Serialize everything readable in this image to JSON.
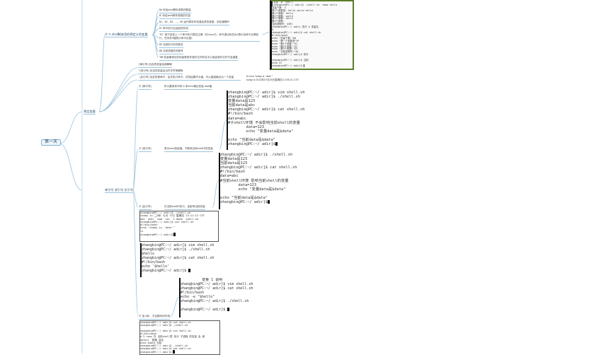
{
  "root": {
    "label": "第一天"
  },
  "branches": {
    "shell_vars": "预定变量",
    "predef": "Ⓟ ✎ shell脚本用的预定义的变量",
    "quotes": "单引号 双引号 反引号"
  },
  "predef_items": [
    "$#    传给shell脚本参数的数量",
    "$*    传给shell脚本参数的内容",
    "$1、$2、$3、...、$9    运行脚本时传递给其的参数，用空格隔开",
    "$?    命令执行后返回的状态",
    "\"$?\" 用于检查上一个命令执行是否正确（在Linux中，命令退出状态为0表示该命令正确执行，任何非0值表示命令出错）",
    "$0    当前执行的进程名",
    "$$    当前进程的进程号",
    "\"$$\"变量最常见的用途是用作临时文件的名字以保证临时文件不会重复"
  ],
  "quote_items": [
    "''(单引号)  包含的变量会被解释",
    "\"\"(双引号)  包含的变量会当作字符串解释",
    "``(反引号)  包含的是命令，会先执行命令，并将结果作为值，可以直接输出为一个变量"
  ],
  "echo_note": [
    "$ echo \"today is `date`\"",
    "today is 2013年07月25日星期四 12:55:21 CST"
  ],
  "single_quote_label": "Ⓟ (单引号)",
  "single_quote_desc": "所以要用到'$'和 \\n 来echo输出变量 data值",
  "double_quote_label": "Ⓟ (双引号)",
  "double_quote_desc": "表示shell变量值，不影响当前shell中的变量",
  "backquote_label": "Ⓟ (反引号)",
  "backquote_desc": "在当前shell中执行，会影响当前变量",
  "export_label": "Ⓟ 加.0和 ., 方包脚本的作用",
  "terminal_top": [
    "▌变量 -p  shell",
    "▌zhangbin@PC:~/ adir]$ ./shell sh  home hello",
    "变量个数: 3",
    "第1个参数是: hello world hello",
    "第1个参数: hello",
    "第2个参数: world",
    "第3个参数: hello",
    "第4个参数: ",
    "当前进程号: 4491",
    "zhangbin@PC:~/ adir] 执行 $ 变量名",
    "0",
    "zhangbin@PC:~/ adir]$ cat shell.sh",
    "#!/bin/bash",
    "echo \"变量个数:\"$#",
    "echo \"第一个参数是\"$*",
    "echo \"第1个参数:\"$1",
    "echo \"第2个参数:\"$2",
    "echo \"第3个参数:\"$3",
    "echo \"当前进程号:\"$$",
    "zhangbin@PC:~/ adir]$ 执行",
    "",
    "zhangbin@PC:~/ adir]$ 当前",
    "echo $?",
    "zhangbin@PC:~/ adir]$ ▌"
  ],
  "terminal_single": [
    "zhangbin@PC:~/ adir]$ vim shell.sh",
    "zhangbin@PC:~/ adir]$ ./shell.sh",
    "变量data是123",
    "当前data是abc",
    "zhangbin@PC:~/ adir]$ cat shell.sh",
    "#!/bin/bash",
    "data=abc",
    "#子shell环境 不会影响当前shell的变量",
    "        data=123",
    "        echo \"变量data是$data\"",
    "",
    "echo \"当前data是$data\"",
    "zhangbin@PC:~/ adir]$"
  ],
  "terminal_double": [
    "zhangbin@PC:~/ adir]$ ./shell.sh",
    "变量data是123",
    "当前data是123",
    "zhangbin@PC:~/ adir]$ cat shell.sh",
    "#!/bin/bash",
    "data=abc",
    "#当前shell环境 影响当前shell的变量",
    "        data=123",
    "        echo \"变量data是$data\"",
    "",
    "echo \"当前data是$data\"",
    "zhangbin@PC:~/ adir]$"
  ],
  "terminal_small1": [
    "zhangbin@PC:~/ adir]$ ./shell.sh",
    "today is 二0年 七月 十日 星期四 13:11:12 CST",
    "adc  adir  bad  co=  1.deme  shell.sh",
    "zhangbin@PC:~/ adir]$ cat shell.sh",
    "#!/bin/bash",
    "echo \"today is `date`\"",
    "ls",
    "zhangbin@PC:~/ adir]$"
  ],
  "terminal_vim": [
    "zhangbin@PC:~/ adir]$ vim shell.sh",
    "zhangbin@PC:~/ adir]$ ./shell.sh",
    "$hello",
    "zhangbin@PC:~/ adir]$ cat shell.sh",
    "#!/bin/bash",
    "echo '$hello'",
    "zhangbin@PC:~/ adir]$ "
  ],
  "terminal_hello": [
    "          变量 1 说明",
    "zhangbin@PC:~/ adir]$ vim shell.sh",
    "zhangbin@PC:~/ adir]$ cat shell.sh",
    "#!/bin/bash",
    "echo -e \"$hello\"",
    "zhangbin@PC:~/ adir]$ ./shell.sh",
    "",
    "zhangbin@PC:~/ adir]$ "
  ],
  "terminal_bottom": [
    "zhangbin@PC:~/ adir]$ cat shell.sh",
    "zhangbin@PC:~/ adir]$ ./shell.sh",
    "",
    "zhangbin@PC:~/ adir]$ vim shell.sh",
    "#!/bin/bash",
    "# 5 rows 在 当前shell里 执行 子进程 的变量 会 被",
    "data=1  数据 变化",
    "echo $data 当前",
    "zhangbin@PC:~/ adir]$ ./shell.sh",
    "zhangbin@PC:~/ adir]$ cat shell.sh",
    "zhangbin@PC:~/ adir]$ "
  ]
}
